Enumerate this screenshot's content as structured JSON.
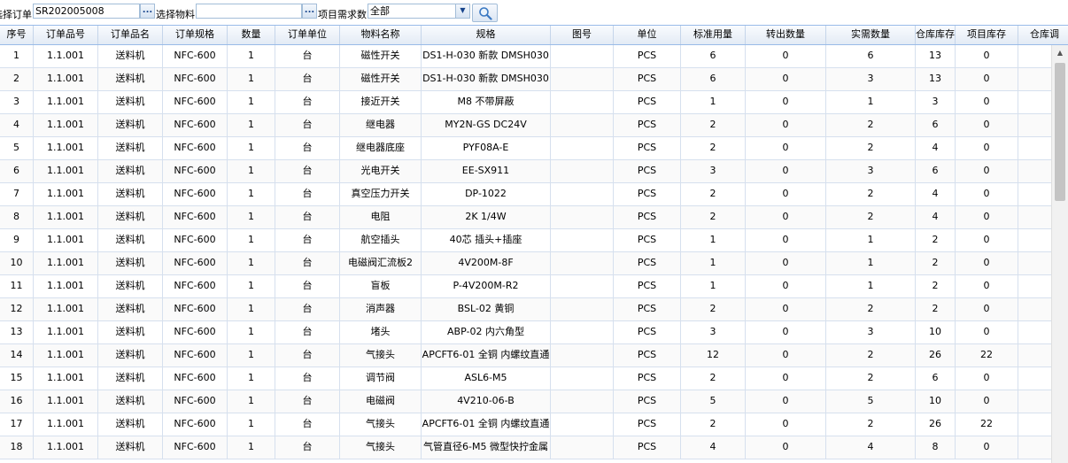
{
  "toolbar": {
    "order_label": "选择订单:",
    "order_value": "SR202005008",
    "order_trigger": "...",
    "material_label": "选择物料:",
    "material_value": "",
    "material_trigger": "...",
    "demand_label": "项目需求数:",
    "demand_value": "全部",
    "demand_trigger": "▼"
  },
  "columns": [
    "序号",
    "订单品号",
    "订单品名",
    "订单规格",
    "数量",
    "订单单位",
    "物料名称",
    "规格",
    "图号",
    "单位",
    "标准用量",
    "转出数量",
    "实需数量",
    "仓库库存",
    "项目库存",
    "仓库调"
  ],
  "rows": [
    [
      "1",
      "1.1.001",
      "送料机",
      "NFC-600",
      "1",
      "台",
      "磁性开关",
      "DS1-H-030 新款 DMSH030",
      "",
      "PCS",
      "6",
      "0",
      "6",
      "13",
      "0",
      ""
    ],
    [
      "2",
      "1.1.001",
      "送料机",
      "NFC-600",
      "1",
      "台",
      "磁性开关",
      "DS1-H-030 新款 DMSH030",
      "",
      "PCS",
      "6",
      "0",
      "3",
      "13",
      "0",
      ""
    ],
    [
      "3",
      "1.1.001",
      "送料机",
      "NFC-600",
      "1",
      "台",
      "接近开关",
      "M8 不带屏蔽",
      "",
      "PCS",
      "1",
      "0",
      "1",
      "3",
      "0",
      ""
    ],
    [
      "4",
      "1.1.001",
      "送料机",
      "NFC-600",
      "1",
      "台",
      "继电器",
      "MY2N-GS DC24V",
      "",
      "PCS",
      "2",
      "0",
      "2",
      "6",
      "0",
      ""
    ],
    [
      "5",
      "1.1.001",
      "送料机",
      "NFC-600",
      "1",
      "台",
      "继电器底座",
      "PYF08A-E",
      "",
      "PCS",
      "2",
      "0",
      "2",
      "4",
      "0",
      ""
    ],
    [
      "6",
      "1.1.001",
      "送料机",
      "NFC-600",
      "1",
      "台",
      "光电开关",
      "EE-SX911",
      "",
      "PCS",
      "3",
      "0",
      "3",
      "6",
      "0",
      ""
    ],
    [
      "7",
      "1.1.001",
      "送料机",
      "NFC-600",
      "1",
      "台",
      "真空压力开关",
      "DP-1022",
      "",
      "PCS",
      "2",
      "0",
      "2",
      "4",
      "0",
      ""
    ],
    [
      "8",
      "1.1.001",
      "送料机",
      "NFC-600",
      "1",
      "台",
      "电阻",
      "2K 1/4W",
      "",
      "PCS",
      "2",
      "0",
      "2",
      "4",
      "0",
      ""
    ],
    [
      "9",
      "1.1.001",
      "送料机",
      "NFC-600",
      "1",
      "台",
      "航空插头",
      "40芯 插头+插座",
      "",
      "PCS",
      "1",
      "0",
      "1",
      "2",
      "0",
      ""
    ],
    [
      "10",
      "1.1.001",
      "送料机",
      "NFC-600",
      "1",
      "台",
      "电磁阀汇流板2",
      "4V200M-8F",
      "",
      "PCS",
      "1",
      "0",
      "1",
      "2",
      "0",
      ""
    ],
    [
      "11",
      "1.1.001",
      "送料机",
      "NFC-600",
      "1",
      "台",
      "盲板",
      "P-4V200M-R2",
      "",
      "PCS",
      "1",
      "0",
      "1",
      "2",
      "0",
      ""
    ],
    [
      "12",
      "1.1.001",
      "送料机",
      "NFC-600",
      "1",
      "台",
      "消声器",
      "BSL-02 黄铜",
      "",
      "PCS",
      "2",
      "0",
      "2",
      "2",
      "0",
      ""
    ],
    [
      "13",
      "1.1.001",
      "送料机",
      "NFC-600",
      "1",
      "台",
      "堵头",
      "ABP-02 内六角型",
      "",
      "PCS",
      "3",
      "0",
      "3",
      "10",
      "0",
      ""
    ],
    [
      "14",
      "1.1.001",
      "送料机",
      "NFC-600",
      "1",
      "台",
      "气接头",
      "APCFT6-01 全铜 内螺纹直通",
      "",
      "PCS",
      "12",
      "0",
      "2",
      "26",
      "22",
      ""
    ],
    [
      "15",
      "1.1.001",
      "送料机",
      "NFC-600",
      "1",
      "台",
      "调节阀",
      "ASL6-M5",
      "",
      "PCS",
      "2",
      "0",
      "2",
      "6",
      "0",
      ""
    ],
    [
      "16",
      "1.1.001",
      "送料机",
      "NFC-600",
      "1",
      "台",
      "电磁阀",
      "4V210-06-B",
      "",
      "PCS",
      "5",
      "0",
      "5",
      "10",
      "0",
      ""
    ],
    [
      "17",
      "1.1.001",
      "送料机",
      "NFC-600",
      "1",
      "台",
      "气接头",
      "APCFT6-01 全铜 内螺纹直通",
      "",
      "PCS",
      "2",
      "0",
      "2",
      "26",
      "22",
      ""
    ],
    [
      "18",
      "1.1.001",
      "送料机",
      "NFC-600",
      "1",
      "台",
      "气接头",
      "气管直径6-M5 微型快拧金属",
      "",
      "PCS",
      "4",
      "0",
      "4",
      "8",
      "0",
      ""
    ]
  ]
}
